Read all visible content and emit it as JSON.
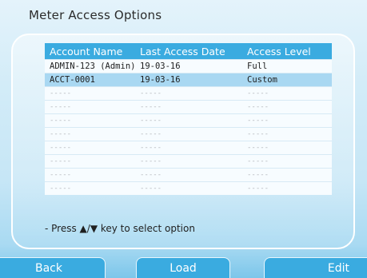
{
  "title": "Meter Access Options",
  "table": {
    "headers": [
      "Account Name",
      "Last Access Date",
      "Access Level"
    ],
    "rows": [
      {
        "name": "ADMIN-123 (Admin)",
        "date": "19-03-16",
        "level": "Full"
      },
      {
        "name": "ACCT-0001",
        "date": "19-03-16",
        "level": "Custom"
      },
      {
        "name": "-----",
        "date": "-----",
        "level": "-----"
      },
      {
        "name": "-----",
        "date": "-----",
        "level": "-----"
      },
      {
        "name": "-----",
        "date": "-----",
        "level": "-----"
      },
      {
        "name": "-----",
        "date": "-----",
        "level": "-----"
      },
      {
        "name": "-----",
        "date": "-----",
        "level": "-----"
      },
      {
        "name": "-----",
        "date": "-----",
        "level": "-----"
      },
      {
        "name": "-----",
        "date": "-----",
        "level": "-----"
      },
      {
        "name": "-----",
        "date": "-----",
        "level": "-----"
      }
    ]
  },
  "hint": "- Press ▲/▼ key to select option",
  "softkeys": {
    "back": "Back",
    "load": "Load",
    "edit": "Edit"
  },
  "colors": {
    "accent": "#3aabe0",
    "selected_row": "#a9d8f2"
  }
}
